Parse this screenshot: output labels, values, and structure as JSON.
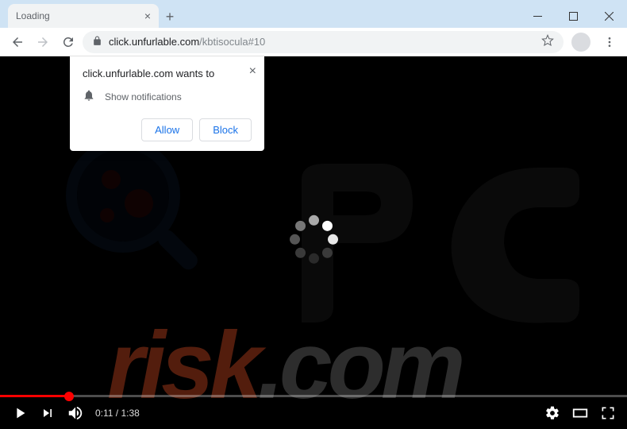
{
  "window": {
    "tab_title": "Loading"
  },
  "address_bar": {
    "domain": "click.unfurlable.com",
    "path": "/kbtisocula#10"
  },
  "permission_prompt": {
    "title": "click.unfurlable.com wants to",
    "item": "Show notifications",
    "allow": "Allow",
    "block": "Block"
  },
  "video": {
    "current_time": "0:11",
    "duration": "1:38",
    "separator": " / "
  },
  "watermark": {
    "risk": "risk",
    "dotcom": ".com"
  }
}
